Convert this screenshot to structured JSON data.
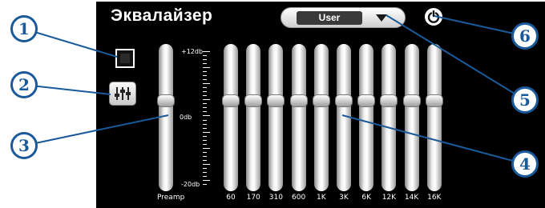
{
  "app": {
    "title": "Эквалайзер"
  },
  "preset": {
    "selected": "User"
  },
  "scale": {
    "top": "+12db",
    "mid": "0db",
    "bottom": "-20db"
  },
  "preamp": {
    "label": "Preamp",
    "level_db": 0
  },
  "bands": [
    {
      "label": "60",
      "level_db": 0
    },
    {
      "label": "170",
      "level_db": 0
    },
    {
      "label": "310",
      "level_db": 0
    },
    {
      "label": "600",
      "level_db": 0
    },
    {
      "label": "1K",
      "level_db": 0
    },
    {
      "label": "3K",
      "level_db": 0
    },
    {
      "label": "6K",
      "level_db": 0
    },
    {
      "label": "12K",
      "level_db": 0
    },
    {
      "label": "14K",
      "level_db": 0
    },
    {
      "label": "16K",
      "level_db": 0
    }
  ],
  "callouts": [
    "1",
    "2",
    "3",
    "4",
    "5",
    "6"
  ],
  "colors": {
    "background": "#000000",
    "callout": "#1b5a9a"
  }
}
